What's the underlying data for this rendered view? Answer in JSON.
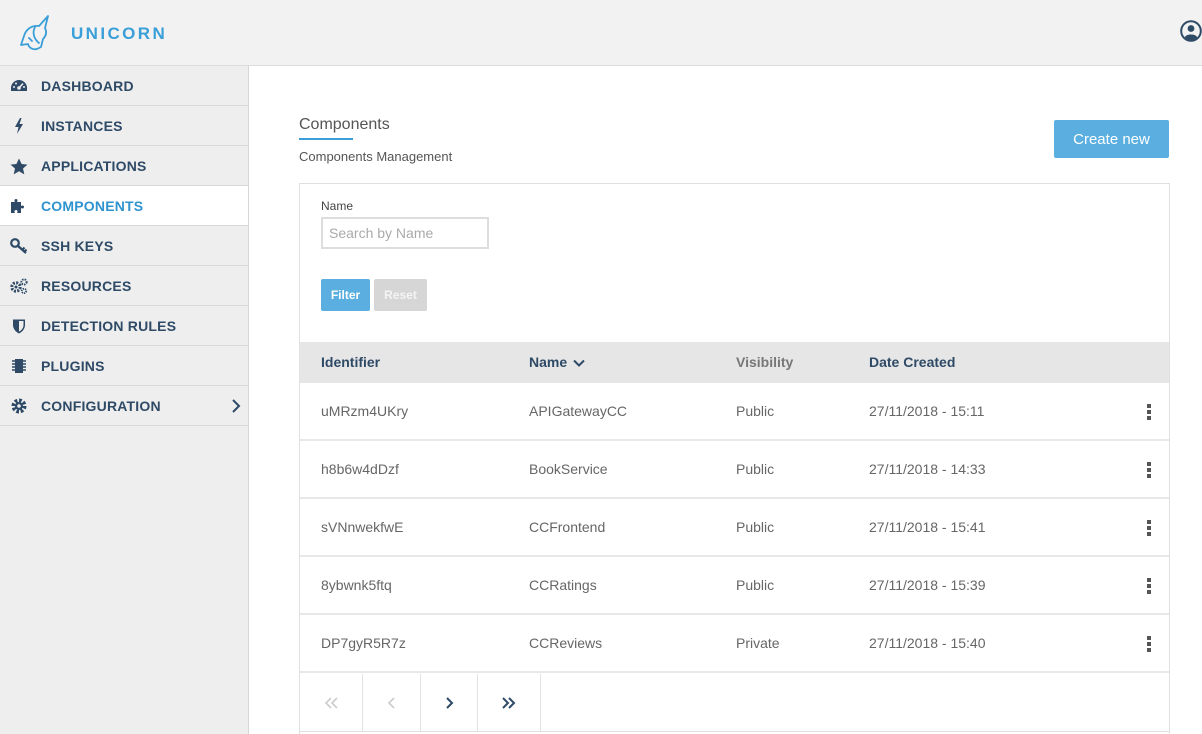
{
  "header": {
    "brand": "UNICORN",
    "logo_icon": "unicorn-logo",
    "user_icon": "user-circle-icon",
    "accent_color": "#3a9fd8"
  },
  "sidebar": {
    "items": [
      {
        "label": "DASHBOARD",
        "icon": "dashboard-icon",
        "active": false
      },
      {
        "label": "INSTANCES",
        "icon": "bolt-icon",
        "active": false
      },
      {
        "label": "APPLICATIONS",
        "icon": "star-icon",
        "active": false
      },
      {
        "label": "COMPONENTS",
        "icon": "puzzle-icon",
        "active": true
      },
      {
        "label": "SSH KEYS",
        "icon": "key-icon",
        "active": false
      },
      {
        "label": "RESOURCES",
        "icon": "gears-icon",
        "active": false
      },
      {
        "label": "DETECTION RULES",
        "icon": "shield-icon",
        "active": false
      },
      {
        "label": "PLUGINS",
        "icon": "chip-icon",
        "active": false
      },
      {
        "label": "CONFIGURATION",
        "icon": "gear-icon",
        "active": false,
        "has_submenu": true
      }
    ]
  },
  "main": {
    "title": "Components",
    "subtitle": "Components Management",
    "create_label": "Create new"
  },
  "filter": {
    "name_label": "Name",
    "name_placeholder": "Search by Name",
    "name_value": "",
    "filter_label": "Filter",
    "reset_label": "Reset"
  },
  "table": {
    "columns": [
      {
        "label": "Identifier",
        "sortable": false
      },
      {
        "label": "Name",
        "sortable": true,
        "sort": "desc"
      },
      {
        "label": "Visibility",
        "sortable": false
      },
      {
        "label": "Date Created",
        "sortable": false
      }
    ],
    "rows": [
      {
        "identifier": "uMRzm4UKry",
        "name": "APIGatewayCC",
        "visibility": "Public",
        "date": "27/11/2018 - 15:11"
      },
      {
        "identifier": "h8b6w4dDzf",
        "name": "BookService",
        "visibility": "Public",
        "date": "27/11/2018 - 14:33"
      },
      {
        "identifier": "sVNnwekfwE",
        "name": "CCFrontend",
        "visibility": "Public",
        "date": "27/11/2018 - 15:41"
      },
      {
        "identifier": "8ybwnk5ftq",
        "name": "CCRatings",
        "visibility": "Public",
        "date": "27/11/2018 - 15:39"
      },
      {
        "identifier": "DP7gyR5R7z",
        "name": "CCReviews",
        "visibility": "Private",
        "date": "27/11/2018 - 15:40"
      }
    ]
  },
  "pagination": {
    "first_icon": "double-chevron-left-icon",
    "prev_icon": "chevron-left-icon",
    "next_icon": "chevron-right-icon",
    "last_icon": "double-chevron-right-icon",
    "first_enabled": false,
    "prev_enabled": false
  }
}
